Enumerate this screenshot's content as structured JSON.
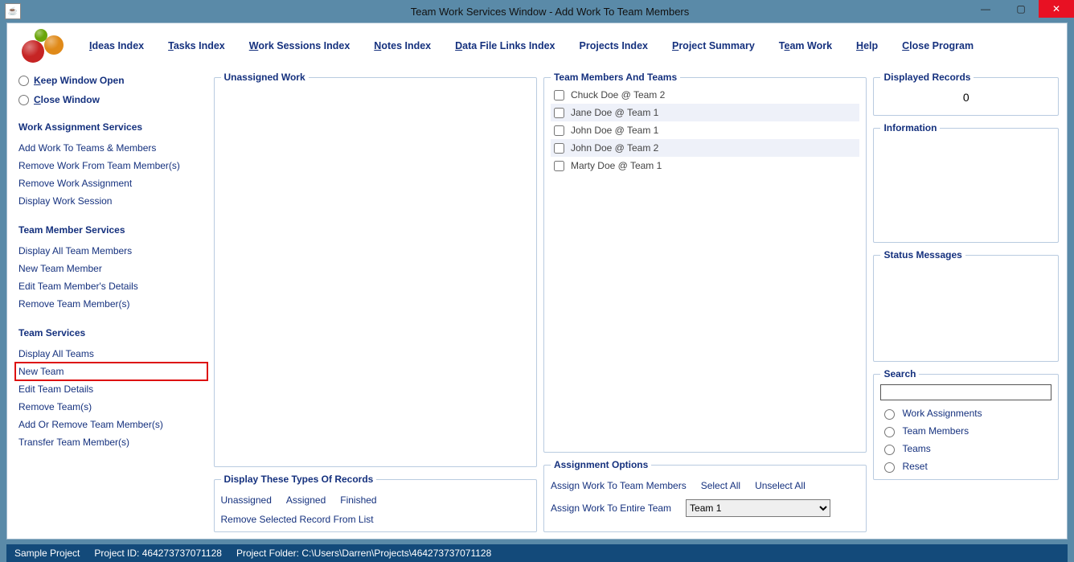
{
  "title": "Team Work Services Window - Add Work To Team Members",
  "menu": {
    "ideas": "Ideas Index",
    "tasks": "Tasks Index",
    "sessions": "Work Sessions Index",
    "notes": "Notes Index",
    "datafile": "Data File Links Index",
    "projects": "Projects Index",
    "summary": "Project Summary",
    "teamwork": "Team Work",
    "help": "Help",
    "close": "Close Program"
  },
  "sidebar": {
    "radio_keep": "Keep Window Open",
    "radio_close": "Close Window",
    "sec_work": "Work Assignment Services",
    "work_links": [
      "Add Work To Teams & Members",
      "Remove Work From Team Member(s)",
      "Remove Work Assignment",
      "Display Work Session"
    ],
    "sec_member": "Team Member Services",
    "member_links": [
      "Display All Team Members",
      "New Team Member",
      "Edit Team Member's Details",
      "Remove Team Member(s)"
    ],
    "sec_team": "Team Services",
    "team_links": [
      "Display All Teams",
      "New Team",
      "Edit Team Details",
      "Remove Team(s)",
      "Add Or Remove Team Member(s)",
      "Transfer Team Member(s)"
    ],
    "highlight_index": 1
  },
  "center_left": {
    "unassigned_title": "Unassigned Work",
    "display_types_title": "Display These Types Of Records",
    "dt_unassigned": "Unassigned",
    "dt_assigned": "Assigned",
    "dt_finished": "Finished",
    "remove_selected": "Remove Selected Record From List"
  },
  "center_right": {
    "team_title": "Team Members And Teams",
    "rows": [
      "Chuck Doe @ Team 2",
      "Jane Doe @ Team 1",
      "John Doe @ Team 1",
      "John Doe @ Team 2",
      "Marty Doe @ Team 1"
    ],
    "assign_title": "Assignment Options",
    "assign_members": "Assign Work To Team Members",
    "select_all": "Select All",
    "unselect_all": "Unselect All",
    "assign_team": "Assign Work To Entire Team",
    "team_select_value": "Team 1"
  },
  "right": {
    "displayed_title": "Displayed Records",
    "displayed_value": "0",
    "info_title": "Information",
    "status_title": "Status Messages",
    "search_title": "Search",
    "search_value": "",
    "opt_work": "Work Assignments",
    "opt_members": "Team Members",
    "opt_teams": "Teams",
    "opt_reset": "Reset"
  },
  "statusbar": {
    "project_name": "Sample Project",
    "project_id_label": "Project ID:",
    "project_id": "464273737071128",
    "folder_label": "Project Folder:",
    "folder": "C:\\Users\\Darren\\Projects\\464273737071128"
  }
}
